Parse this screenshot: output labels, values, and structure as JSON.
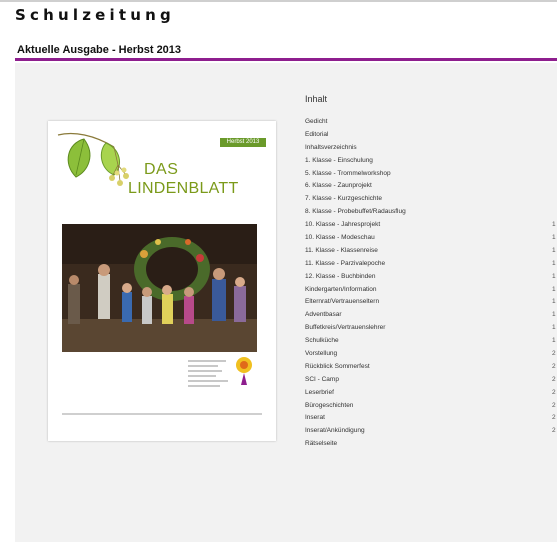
{
  "header": {
    "site_title": "Schulzeitung",
    "issue_heading": "Aktuelle Ausgabe - Herbst 2013"
  },
  "colors": {
    "accent": "#8e1e8e",
    "cover_green": "#7b9a1a",
    "badge_green": "#6a9a2a",
    "content_bg": "#f2f2f2"
  },
  "cover": {
    "badge": "Herbst 2013",
    "title_line1": "DAS",
    "title_line2": "LINDENBLATT"
  },
  "toc": {
    "title": "Inhalt",
    "items": [
      {
        "label": "Gedicht",
        "page": ""
      },
      {
        "label": "Editorial",
        "page": ""
      },
      {
        "label": "Inhaltsverzeichnis",
        "page": ""
      },
      {
        "label": "1. Klasse - Einschulung",
        "page": ""
      },
      {
        "label": "5. Klasse - Trommelworkshop",
        "page": ""
      },
      {
        "label": "6. Klasse - Zaunprojekt",
        "page": ""
      },
      {
        "label": "7. Klasse - Kurzgeschichte",
        "page": ""
      },
      {
        "label": "8. Klasse - Probebuffet/Radausflug",
        "page": ""
      },
      {
        "label": "10. Klasse - Jahresprojekt",
        "page": "1"
      },
      {
        "label": "10. Klasse - Modeschau",
        "page": "1"
      },
      {
        "label": "11. Klasse - Klassenreise",
        "page": "1"
      },
      {
        "label": "11. Klasse - Parzivalepoche",
        "page": "1"
      },
      {
        "label": "12. Klasse - Buchbinden",
        "page": "1"
      },
      {
        "label": "Kindergarten/Information",
        "page": "1"
      },
      {
        "label": "Elternrat/Vertrauenseltern",
        "page": "1"
      },
      {
        "label": "Adventbasar",
        "page": "1"
      },
      {
        "label": "Buffetkreis/Vertrauenslehrer",
        "page": "1"
      },
      {
        "label": "Schulküche",
        "page": "1"
      },
      {
        "label": "Vorstellung",
        "page": "2"
      },
      {
        "label": "Rückblick Sommerfest",
        "page": "2"
      },
      {
        "label": "SCI - Camp",
        "page": "2"
      },
      {
        "label": "Leserbrief",
        "page": "2"
      },
      {
        "label": "Bürogeschichten",
        "page": "2"
      },
      {
        "label": "Inserat",
        "page": "2"
      },
      {
        "label": "Inserat/Ankündigung",
        "page": "2"
      },
      {
        "label": "Rätselseite",
        "page": ""
      }
    ]
  }
}
